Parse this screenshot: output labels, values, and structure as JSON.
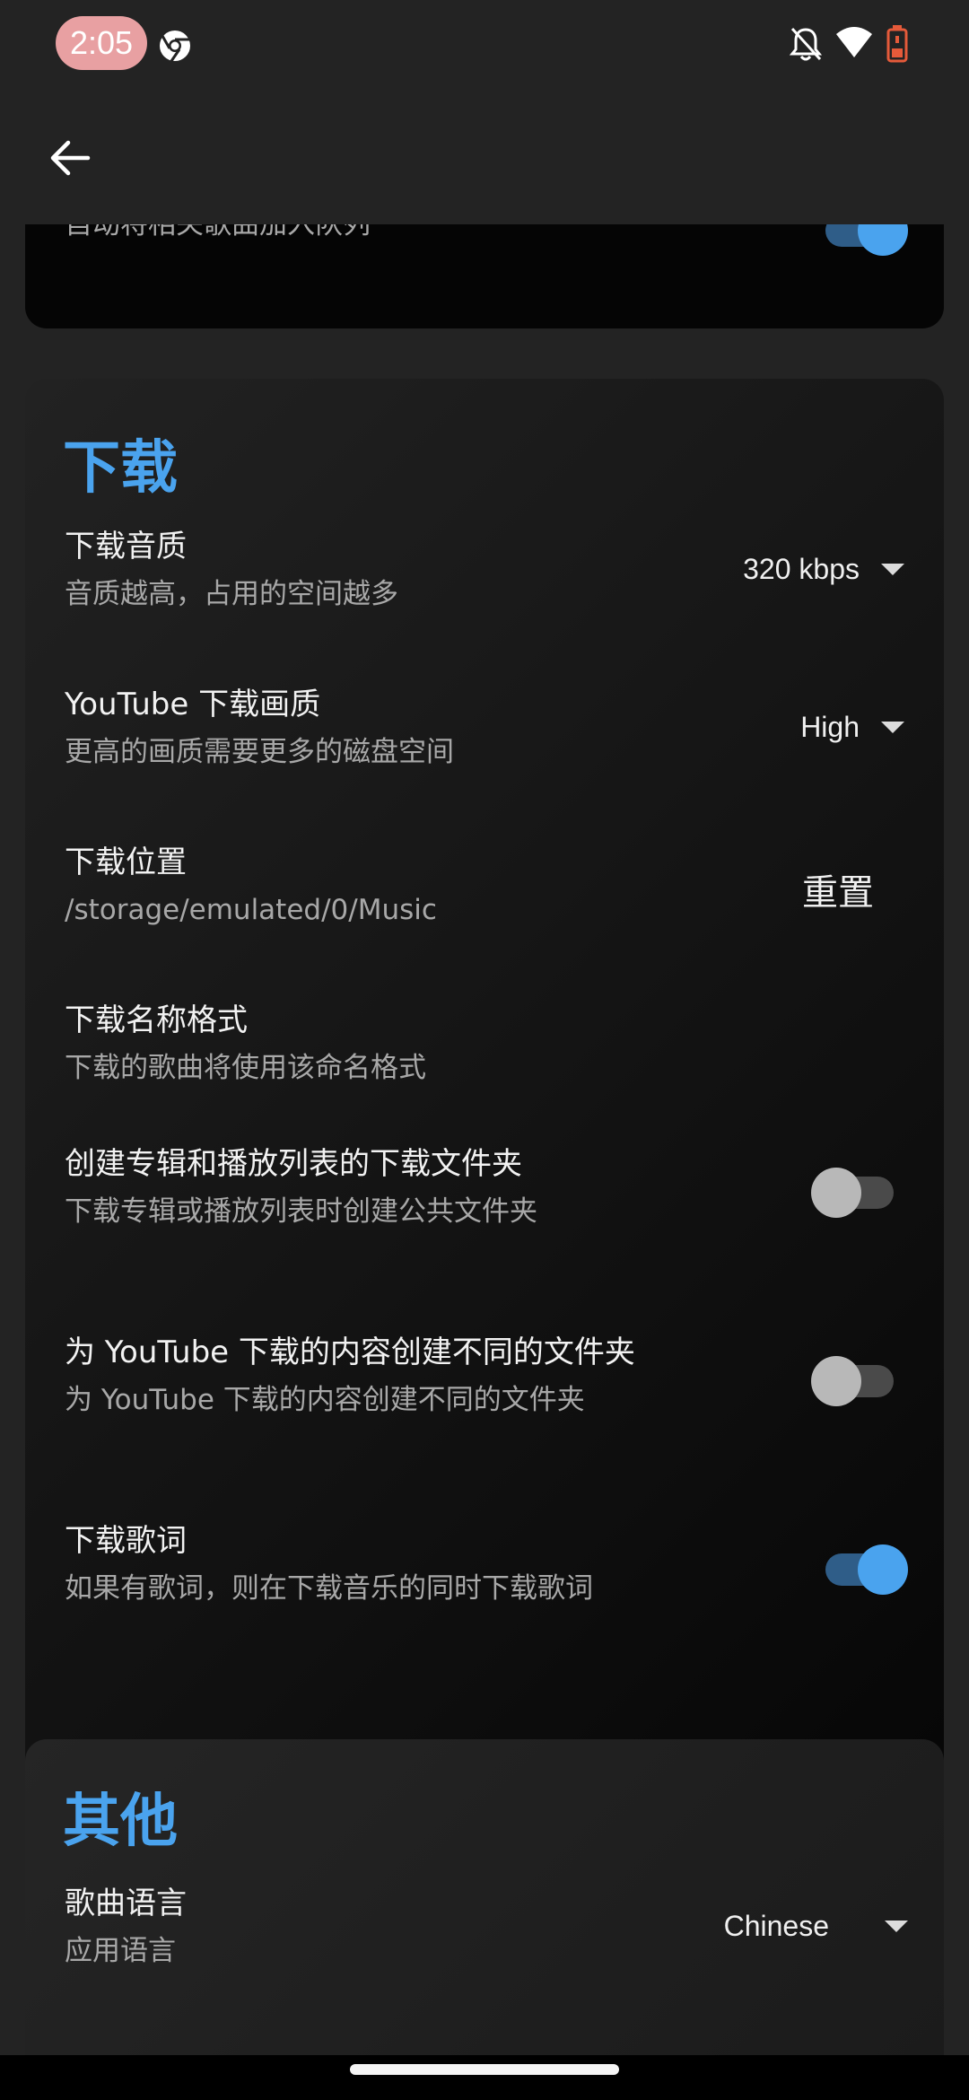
{
  "status_bar": {
    "time": "2:05",
    "icons": [
      "chrome-icon",
      "bell-off-icon",
      "wifi-icon",
      "battery-icon"
    ]
  },
  "app_bar": {
    "back_icon": "arrow-left-icon"
  },
  "autoplay": {
    "subtitle": "自动将相关歌曲加入队列",
    "enabled": true
  },
  "download": {
    "title": "下载",
    "quality": {
      "title": "下载音质",
      "subtitle": "音质越高，占用的空间越多",
      "value": "320 kbps"
    },
    "yt_quality": {
      "title": "YouTube 下载画质",
      "subtitle": "更高的画质需要更多的磁盘空间",
      "value": "High"
    },
    "location": {
      "title": "下载位置",
      "subtitle": "/storage/emulated/0/Music",
      "reset_label": "重置"
    },
    "name_format": {
      "title": "下载名称格式",
      "subtitle": "下载的歌曲将使用该命名格式"
    },
    "album_folders": {
      "title": "创建专辑和播放列表的下载文件夹",
      "subtitle": "下载专辑或播放列表时创建公共文件夹",
      "enabled": false
    },
    "yt_folders": {
      "title": "为 YouTube 下载的内容创建不同的文件夹",
      "subtitle": "为 YouTube 下载的内容创建不同的文件夹",
      "enabled": false
    },
    "lyrics": {
      "title": "下载歌词",
      "subtitle": "如果有歌词，则在下载音乐的同时下载歌词",
      "enabled": true
    }
  },
  "other": {
    "title": "其他",
    "language": {
      "title": "歌曲语言",
      "subtitle": "应用语言",
      "value": "Chinese"
    }
  },
  "colors": {
    "accent": "#4aa3ee",
    "background": "#232323",
    "card": "#0b0b0b"
  }
}
